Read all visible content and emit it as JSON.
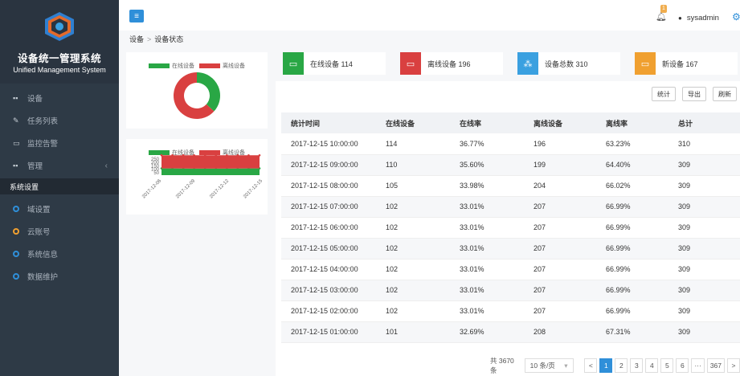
{
  "brand": {
    "name_cn": "设备统一管理系统",
    "name_en": "Unified Management System",
    "logo": "hexagon-logo"
  },
  "menu": {
    "device": "设备",
    "tasks": "任务列表",
    "monitor": "监控告警",
    "manage": "管理",
    "section": "系统设置",
    "sub": [
      {
        "label": "域设置",
        "color": "#2f8fd9"
      },
      {
        "label": "云账号",
        "color": "#f0a030"
      },
      {
        "label": "系统信息",
        "color": "#2f8fd9"
      },
      {
        "label": "数据维护",
        "color": "#2f8fd9"
      }
    ]
  },
  "topbar": {
    "badge": "1",
    "username": "sysadmin"
  },
  "breadcrumb": {
    "root": "设备",
    "sep": ">",
    "current": "设备状态"
  },
  "legend": {
    "online": "在线设备",
    "offline": "离线设备",
    "online_color": "#29a745",
    "offline_color": "#d94040"
  },
  "chart_data": [
    {
      "type": "pie",
      "series": [
        {
          "name": "在线设备",
          "value": 114
        },
        {
          "name": "离线设备",
          "value": 196
        }
      ]
    },
    {
      "type": "area",
      "x": [
        "2017-12-06",
        "2017-12-09",
        "2017-12-12",
        "2017-12-15"
      ],
      "yticks": [
        "250",
        "200",
        "150",
        "100",
        "50"
      ],
      "ylim": [
        0,
        250
      ],
      "series": [
        {
          "name": "在线设备",
          "values": [
            105,
            104,
            103,
            102,
            102,
            102,
            102,
            103,
            104,
            105
          ]
        },
        {
          "name": "离线设备",
          "values": [
            205,
            206,
            207,
            207,
            207,
            207,
            207,
            206,
            205,
            204
          ]
        }
      ]
    }
  ],
  "cards": [
    {
      "label": "在线设备 114",
      "color": "#29a745",
      "icon": "printer-icon"
    },
    {
      "label": "离线设备 196",
      "color": "#d94040",
      "icon": "printer-icon"
    },
    {
      "label": "设备总数 310",
      "color": "#3aa0e0",
      "icon": "cubes-icon"
    },
    {
      "label": "新设备 167",
      "color": "#f0a030",
      "icon": "printer-icon"
    }
  ],
  "toolbar": {
    "stats": "统计",
    "export": "导出",
    "refresh": "刷新"
  },
  "table": {
    "headers": [
      "统计时间",
      "在线设备",
      "在线率",
      "离线设备",
      "离线率",
      "总计"
    ],
    "rows": [
      [
        "2017-12-15 10:00:00",
        "114",
        "36.77%",
        "196",
        "63.23%",
        "310"
      ],
      [
        "2017-12-15 09:00:00",
        "110",
        "35.60%",
        "199",
        "64.40%",
        "309"
      ],
      [
        "2017-12-15 08:00:00",
        "105",
        "33.98%",
        "204",
        "66.02%",
        "309"
      ],
      [
        "2017-12-15 07:00:00",
        "102",
        "33.01%",
        "207",
        "66.99%",
        "309"
      ],
      [
        "2017-12-15 06:00:00",
        "102",
        "33.01%",
        "207",
        "66.99%",
        "309"
      ],
      [
        "2017-12-15 05:00:00",
        "102",
        "33.01%",
        "207",
        "66.99%",
        "309"
      ],
      [
        "2017-12-15 04:00:00",
        "102",
        "33.01%",
        "207",
        "66.99%",
        "309"
      ],
      [
        "2017-12-15 03:00:00",
        "102",
        "33.01%",
        "207",
        "66.99%",
        "309"
      ],
      [
        "2017-12-15 02:00:00",
        "102",
        "33.01%",
        "207",
        "66.99%",
        "309"
      ],
      [
        "2017-12-15 01:00:00",
        "101",
        "32.69%",
        "208",
        "67.31%",
        "309"
      ]
    ]
  },
  "pager": {
    "total": "共 3670 条",
    "page_size": "10 条/页",
    "pages": [
      "1",
      "2",
      "3",
      "4",
      "5",
      "6",
      "···",
      "367"
    ],
    "prev": "<",
    "next": ">"
  }
}
